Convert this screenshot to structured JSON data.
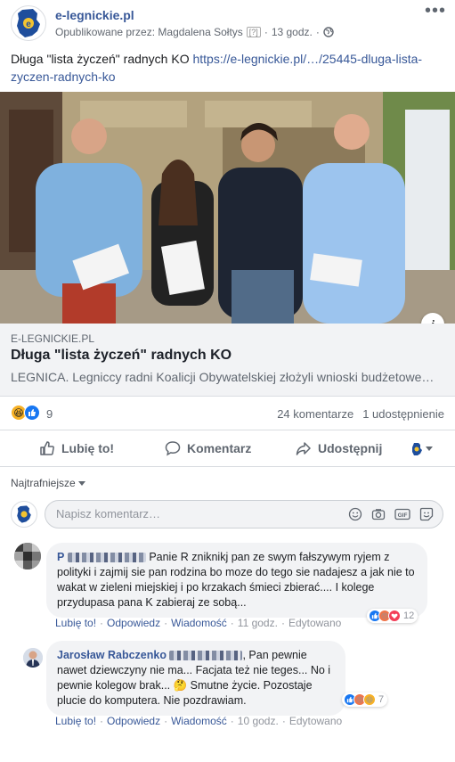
{
  "post": {
    "page_name": "e-legnickie.pl",
    "published_by": "Opublikowane przez: Magdalena Sołtys",
    "published_hint": "[?]",
    "time": "13 godz.",
    "text": "Długa \"lista życzeń\" radnych KO ",
    "link_text": "https://e-legnickie.pl/…/25445-dluga-lista-zyczen-radnych-ko"
  },
  "link_preview": {
    "domain": "E-LEGNICKIE.PL",
    "title": "Długa \"lista życzeń\" radnych KO",
    "description": "LEGNICA. Legniccy radni Koalicji Obywatelskiej złożyli wnioski budżetowe…"
  },
  "stats": {
    "reactions_count": "9",
    "comments": "24 komentarze",
    "shares": "1 udostępnienie"
  },
  "actions": {
    "like": "Lubię to!",
    "comment": "Komentarz",
    "share": "Udostępnij"
  },
  "comments_section": {
    "sort_label": "Najtrafniejsze",
    "composer_placeholder": "Napisz komentarz…"
  },
  "comments": [
    {
      "author": "P",
      "text": "Panie R zniknikj pan ze swym fałszywym ryjem z polityki i zajmij sie pan rodzina bo moze do tego sie nadajesz a jak nie to wakat w zieleni miejskiej i po krzakach śmieci zbierać.... I kolege przydupasa pana K zabieraj ze sobą...",
      "like": "Lubię to!",
      "reply": "Odpowiedz",
      "message": "Wiadomość",
      "time": "11 godz.",
      "edited": "Edytowano",
      "reaction_count": "12"
    },
    {
      "author": "Jarosław Rabczenko",
      "text": ", Pan pewnie nawet dziewczyny nie ma... Facjata też nie teges... No i pewnie kolegow brak... 🤔 Smutne życie. Pozostaje plucie do komputera. Nie pozdrawiam.",
      "like": "Lubię to!",
      "reply": "Odpowiedz",
      "message": "Wiadomość",
      "time": "10 godz.",
      "edited": "Edytowano",
      "reaction_count": "7"
    }
  ],
  "colors": {
    "link_blue": "#385898",
    "muted_gray": "#606770",
    "bubble_bg": "#f2f3f5",
    "like_blue": "#1877f2",
    "angry_orange": "#f0744a",
    "love_red": "#f33e58",
    "haha_yellow": "#f7b125"
  },
  "icons": {
    "header_menu": "more-dots-icon",
    "globe": "globe-icon",
    "info": "info-icon",
    "like": "thumbs-up-icon",
    "comment": "speech-bubble-icon",
    "share": "share-arrow-icon",
    "dropdown": "chevron-down-icon",
    "composer": [
      "emoji-icon",
      "camera-icon",
      "gif-icon",
      "sticker-icon"
    ]
  }
}
